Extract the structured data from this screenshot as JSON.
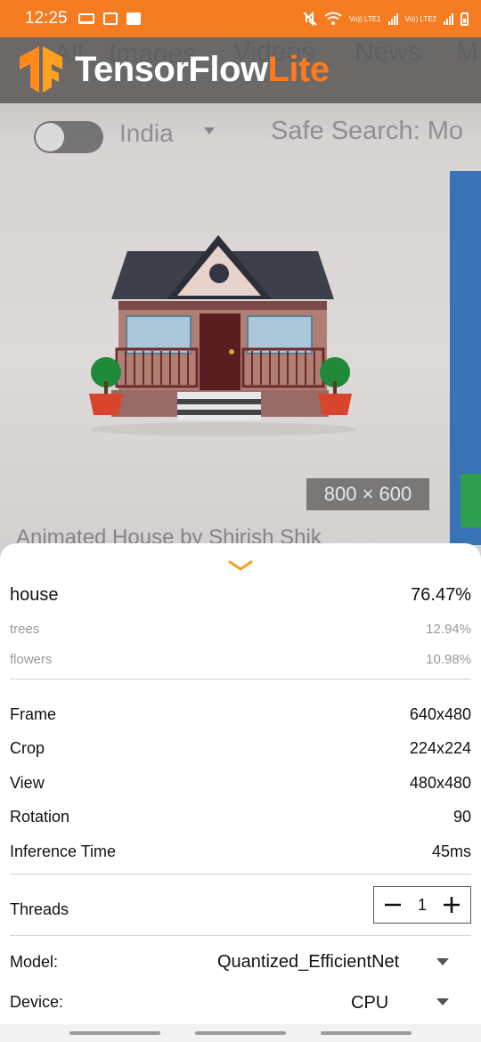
{
  "status_bar": {
    "time": "12:25",
    "lte1": "Vo)) LTE1",
    "lte2": "Vo)) LTE2",
    "icons": [
      "laptop-icon",
      "image-settings-icon",
      "check-icon",
      "mute-icon",
      "wifi-icon",
      "signal-icon",
      "battery-icon"
    ]
  },
  "camera": {
    "ghost_tabs": [
      "All",
      "Images",
      "Videos",
      "News",
      "M"
    ],
    "region": "India",
    "safe_search": "Safe Search: Mo",
    "image_size": "800 × 600",
    "caption": "Animated House by Shirish Shik"
  },
  "logo": {
    "text_main": "TensorFlow",
    "text_accent": "Lite",
    "accent_color": "#ff7a1a"
  },
  "results": [
    {
      "label": "house",
      "score": "76.47%"
    },
    {
      "label": "trees",
      "score": "12.94%"
    },
    {
      "label": "flowers",
      "score": "10.98%"
    }
  ],
  "info": [
    {
      "label": "Frame",
      "value": "640x480"
    },
    {
      "label": "Crop",
      "value": "224x224"
    },
    {
      "label": "View",
      "value": "480x480"
    },
    {
      "label": "Rotation",
      "value": "90"
    },
    {
      "label": "Inference Time",
      "value": "45ms"
    }
  ],
  "threads": {
    "label": "Threads",
    "value": "1"
  },
  "model": {
    "label": "Model:",
    "value": "Quantized_EfficientNet"
  },
  "device": {
    "label": "Device:",
    "value": "CPU"
  },
  "colors": {
    "status_bar": "#f57c20",
    "accent": "#f5a020"
  }
}
